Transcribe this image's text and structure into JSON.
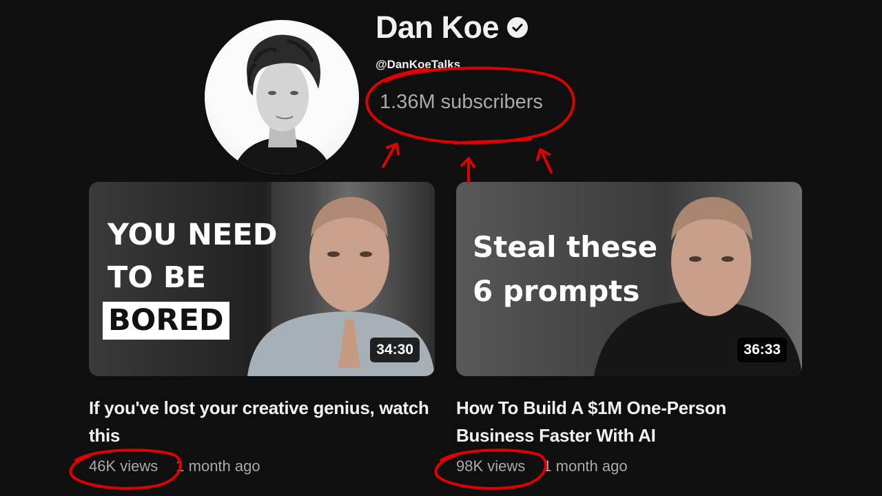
{
  "channel": {
    "name": "Dan Koe",
    "verified_icon": "check-circle-icon",
    "handle": "@DanKoeTalks",
    "subscribers": "1.36M subscribers"
  },
  "videos": [
    {
      "thumbnail_text_lines": [
        "YOU NEED",
        "TO BE",
        "BORED"
      ],
      "duration": "34:30",
      "title": "If you've lost your creative genius, watch this",
      "views": "46K views",
      "age": "1 month ago"
    },
    {
      "thumbnail_text_lines": [
        "Steal these",
        "6 prompts"
      ],
      "duration": "36:33",
      "title": "How To Build A $1M One-Person Business Faster With AI",
      "views": "98K views",
      "age": "1 month ago"
    }
  ],
  "annotation_color": "#e00000"
}
